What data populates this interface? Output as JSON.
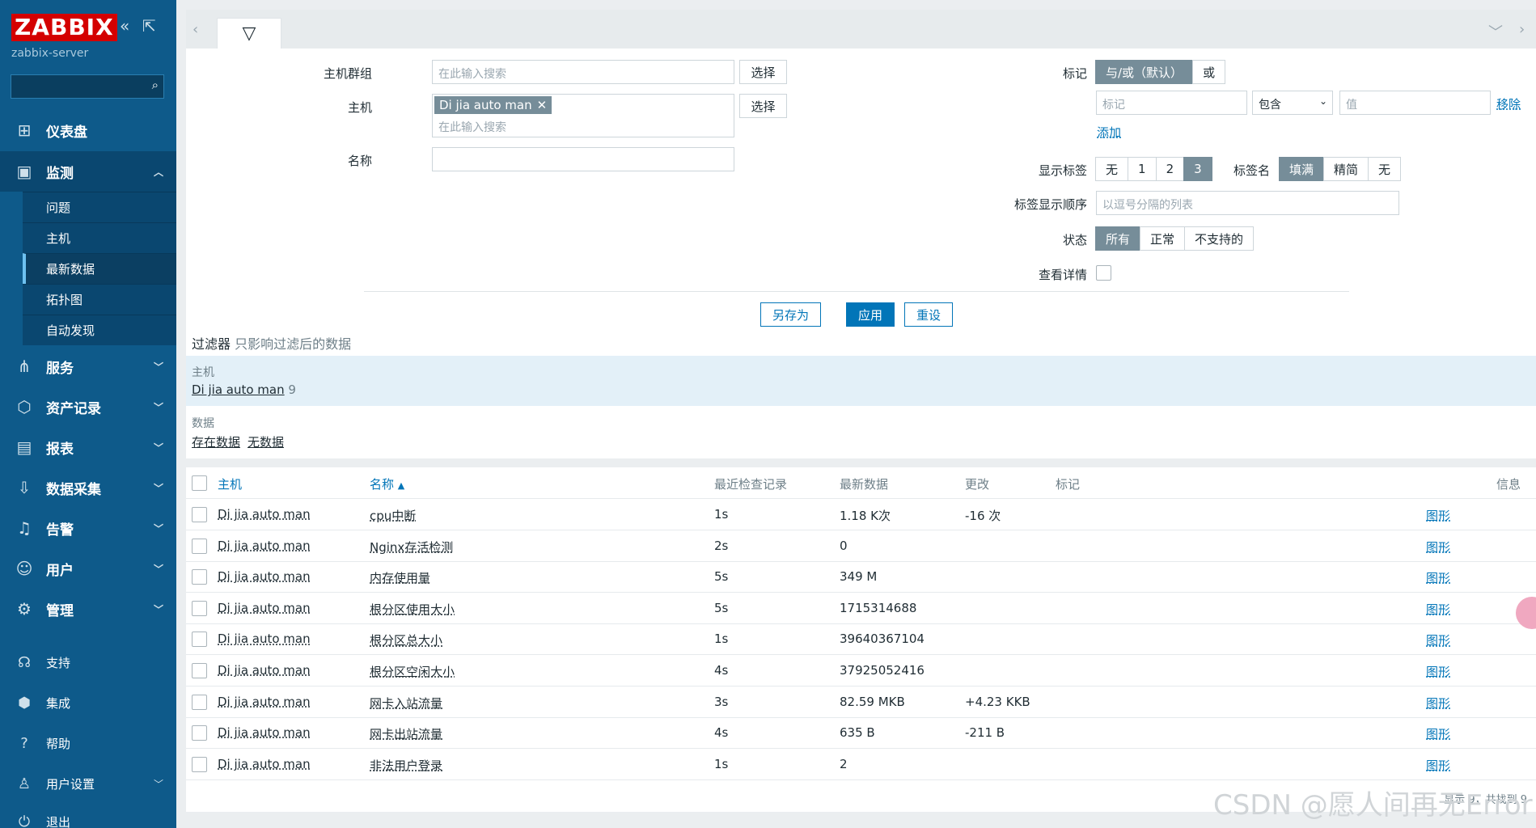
{
  "sidebar": {
    "logo": "ZABBIX",
    "server": "zabbix-server",
    "nav": [
      {
        "label": "仪表盘",
        "icon": "dashboard-icon",
        "glyph": "⊞"
      },
      {
        "label": "监测",
        "icon": "monitoring-icon",
        "glyph": "▣"
      },
      {
        "label": "服务",
        "icon": "services-icon",
        "glyph": "⋔"
      },
      {
        "label": "资产记录",
        "icon": "inventory-icon",
        "glyph": "⬡"
      },
      {
        "label": "报表",
        "icon": "reports-icon",
        "glyph": "▤"
      },
      {
        "label": "数据采集",
        "icon": "data-collection-icon",
        "glyph": "⇩"
      },
      {
        "label": "告警",
        "icon": "alerts-icon",
        "glyph": "♫"
      },
      {
        "label": "用户",
        "icon": "users-icon",
        "glyph": "☺"
      },
      {
        "label": "管理",
        "icon": "administration-icon",
        "glyph": "⚙"
      }
    ],
    "monitoring_sub": [
      "问题",
      "主机",
      "最新数据",
      "拓扑图",
      "自动发现"
    ],
    "bottom": [
      {
        "label": "支持",
        "icon": "support-icon",
        "glyph": "☊"
      },
      {
        "label": "集成",
        "icon": "integrations-icon",
        "glyph": "⬢"
      },
      {
        "label": "帮助",
        "icon": "help-icon",
        "glyph": "?"
      },
      {
        "label": "用户设置",
        "icon": "user-settings-icon",
        "glyph": "♙"
      },
      {
        "label": "退出",
        "icon": "logout-icon",
        "glyph": "⏻"
      }
    ]
  },
  "filter": {
    "host_groups_label": "主机群组",
    "host_groups_placeholder": "在此输入搜索",
    "select_label": "选择",
    "hosts_label": "主机",
    "host_chip": "Di jia auto man",
    "hosts_placeholder": "在此输入搜索",
    "name_label": "名称",
    "tags_label": "标记",
    "tags_andor": "与/或（默认）",
    "tags_or": "或",
    "tag_placeholder": "标记",
    "tag_operator": "包含",
    "value_placeholder": "值",
    "remove_label": "移除",
    "add_label": "添加",
    "show_tags_label": "显示标签",
    "show_tags_options": [
      "无",
      "1",
      "2",
      "3"
    ],
    "tag_name_label": "标签名",
    "tag_name_options": [
      "填满",
      "精简",
      "无"
    ],
    "tag_order_label": "标签显示顺序",
    "tag_order_placeholder": "以逗号分隔的列表",
    "state_label": "状态",
    "state_options": [
      "所有",
      "正常",
      "不支持的"
    ],
    "details_label": "查看详情",
    "save_as": "另存为",
    "apply": "应用",
    "reset": "重设"
  },
  "summary": {
    "title": "过滤器",
    "subtitle": "只影响过滤后的数据",
    "host_heading": "主机",
    "host_name": "Di jia auto man",
    "host_count": "9",
    "data_heading": "数据",
    "data_with": "存在数据",
    "data_without": "无数据"
  },
  "table": {
    "headers": {
      "host": "主机",
      "name": "名称",
      "last_check": "最近检查记录",
      "last_value": "最新数据",
      "change": "更改",
      "tags": "标记",
      "info": "信息"
    },
    "graph_label": "图形",
    "rows": [
      {
        "host": "Di jia auto man",
        "name": "cpu中断",
        "last_check": "1s",
        "last_value": "1.18 K次",
        "change": "-16 次"
      },
      {
        "host": "Di jia auto man",
        "name": "Nginx存活检测",
        "last_check": "2s",
        "last_value": "0",
        "change": ""
      },
      {
        "host": "Di jia auto man",
        "name": "内存使用量",
        "last_check": "5s",
        "last_value": "349 M",
        "change": ""
      },
      {
        "host": "Di jia auto man",
        "name": "根分区使用大小",
        "last_check": "5s",
        "last_value": "1715314688",
        "change": ""
      },
      {
        "host": "Di jia auto man",
        "name": "根分区总大小",
        "last_check": "1s",
        "last_value": "39640367104",
        "change": ""
      },
      {
        "host": "Di jia auto man",
        "name": "根分区空闲大小",
        "last_check": "4s",
        "last_value": "37925052416",
        "change": ""
      },
      {
        "host": "Di jia auto man",
        "name": "网卡入站流量",
        "last_check": "3s",
        "last_value": "82.59 MKB",
        "change": "+4.23 KKB"
      },
      {
        "host": "Di jia auto man",
        "name": "网卡出站流量",
        "last_check": "4s",
        "last_value": "635 B",
        "change": "-211 B"
      },
      {
        "host": "Di jia auto man",
        "name": "非法用户登录",
        "last_check": "1s",
        "last_value": "2",
        "change": ""
      }
    ],
    "footer": "显示 9，共找到 9"
  },
  "watermark": "CSDN @愿人间再无Error"
}
